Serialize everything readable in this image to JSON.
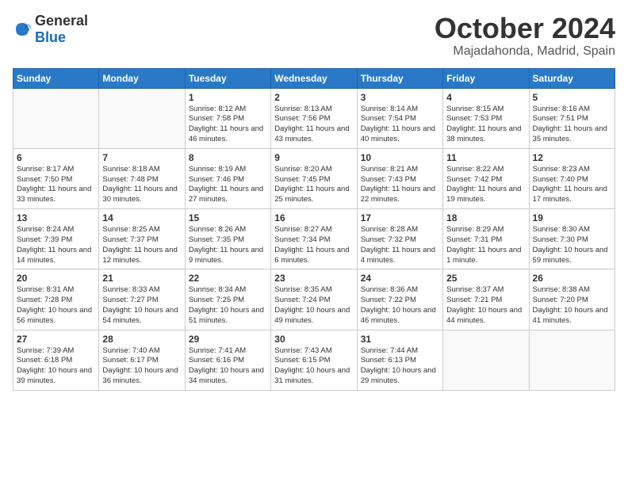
{
  "logo": {
    "general": "General",
    "blue": "Blue"
  },
  "title": "October 2024",
  "location": "Majadahonda, Madrid, Spain",
  "weekdays": [
    "Sunday",
    "Monday",
    "Tuesday",
    "Wednesday",
    "Thursday",
    "Friday",
    "Saturday"
  ],
  "weeks": [
    [
      {
        "day": "",
        "info": ""
      },
      {
        "day": "",
        "info": ""
      },
      {
        "day": "1",
        "info": "Sunrise: 8:12 AM\nSunset: 7:58 PM\nDaylight: 11 hours and 46 minutes."
      },
      {
        "day": "2",
        "info": "Sunrise: 8:13 AM\nSunset: 7:56 PM\nDaylight: 11 hours and 43 minutes."
      },
      {
        "day": "3",
        "info": "Sunrise: 8:14 AM\nSunset: 7:54 PM\nDaylight: 11 hours and 40 minutes."
      },
      {
        "day": "4",
        "info": "Sunrise: 8:15 AM\nSunset: 7:53 PM\nDaylight: 11 hours and 38 minutes."
      },
      {
        "day": "5",
        "info": "Sunrise: 8:16 AM\nSunset: 7:51 PM\nDaylight: 11 hours and 35 minutes."
      }
    ],
    [
      {
        "day": "6",
        "info": "Sunrise: 8:17 AM\nSunset: 7:50 PM\nDaylight: 11 hours and 33 minutes."
      },
      {
        "day": "7",
        "info": "Sunrise: 8:18 AM\nSunset: 7:48 PM\nDaylight: 11 hours and 30 minutes."
      },
      {
        "day": "8",
        "info": "Sunrise: 8:19 AM\nSunset: 7:46 PM\nDaylight: 11 hours and 27 minutes."
      },
      {
        "day": "9",
        "info": "Sunrise: 8:20 AM\nSunset: 7:45 PM\nDaylight: 11 hours and 25 minutes."
      },
      {
        "day": "10",
        "info": "Sunrise: 8:21 AM\nSunset: 7:43 PM\nDaylight: 11 hours and 22 minutes."
      },
      {
        "day": "11",
        "info": "Sunrise: 8:22 AM\nSunset: 7:42 PM\nDaylight: 11 hours and 19 minutes."
      },
      {
        "day": "12",
        "info": "Sunrise: 8:23 AM\nSunset: 7:40 PM\nDaylight: 11 hours and 17 minutes."
      }
    ],
    [
      {
        "day": "13",
        "info": "Sunrise: 8:24 AM\nSunset: 7:39 PM\nDaylight: 11 hours and 14 minutes."
      },
      {
        "day": "14",
        "info": "Sunrise: 8:25 AM\nSunset: 7:37 PM\nDaylight: 11 hours and 12 minutes."
      },
      {
        "day": "15",
        "info": "Sunrise: 8:26 AM\nSunset: 7:35 PM\nDaylight: 11 hours and 9 minutes."
      },
      {
        "day": "16",
        "info": "Sunrise: 8:27 AM\nSunset: 7:34 PM\nDaylight: 11 hours and 6 minutes."
      },
      {
        "day": "17",
        "info": "Sunrise: 8:28 AM\nSunset: 7:32 PM\nDaylight: 11 hours and 4 minutes."
      },
      {
        "day": "18",
        "info": "Sunrise: 8:29 AM\nSunset: 7:31 PM\nDaylight: 11 hours and 1 minute."
      },
      {
        "day": "19",
        "info": "Sunrise: 8:30 AM\nSunset: 7:30 PM\nDaylight: 10 hours and 59 minutes."
      }
    ],
    [
      {
        "day": "20",
        "info": "Sunrise: 8:31 AM\nSunset: 7:28 PM\nDaylight: 10 hours and 56 minutes."
      },
      {
        "day": "21",
        "info": "Sunrise: 8:33 AM\nSunset: 7:27 PM\nDaylight: 10 hours and 54 minutes."
      },
      {
        "day": "22",
        "info": "Sunrise: 8:34 AM\nSunset: 7:25 PM\nDaylight: 10 hours and 51 minutes."
      },
      {
        "day": "23",
        "info": "Sunrise: 8:35 AM\nSunset: 7:24 PM\nDaylight: 10 hours and 49 minutes."
      },
      {
        "day": "24",
        "info": "Sunrise: 8:36 AM\nSunset: 7:22 PM\nDaylight: 10 hours and 46 minutes."
      },
      {
        "day": "25",
        "info": "Sunrise: 8:37 AM\nSunset: 7:21 PM\nDaylight: 10 hours and 44 minutes."
      },
      {
        "day": "26",
        "info": "Sunrise: 8:38 AM\nSunset: 7:20 PM\nDaylight: 10 hours and 41 minutes."
      }
    ],
    [
      {
        "day": "27",
        "info": "Sunrise: 7:39 AM\nSunset: 6:18 PM\nDaylight: 10 hours and 39 minutes."
      },
      {
        "day": "28",
        "info": "Sunrise: 7:40 AM\nSunset: 6:17 PM\nDaylight: 10 hours and 36 minutes."
      },
      {
        "day": "29",
        "info": "Sunrise: 7:41 AM\nSunset: 6:16 PM\nDaylight: 10 hours and 34 minutes."
      },
      {
        "day": "30",
        "info": "Sunrise: 7:43 AM\nSunset: 6:15 PM\nDaylight: 10 hours and 31 minutes."
      },
      {
        "day": "31",
        "info": "Sunrise: 7:44 AM\nSunset: 6:13 PM\nDaylight: 10 hours and 29 minutes."
      },
      {
        "day": "",
        "info": ""
      },
      {
        "day": "",
        "info": ""
      }
    ]
  ]
}
